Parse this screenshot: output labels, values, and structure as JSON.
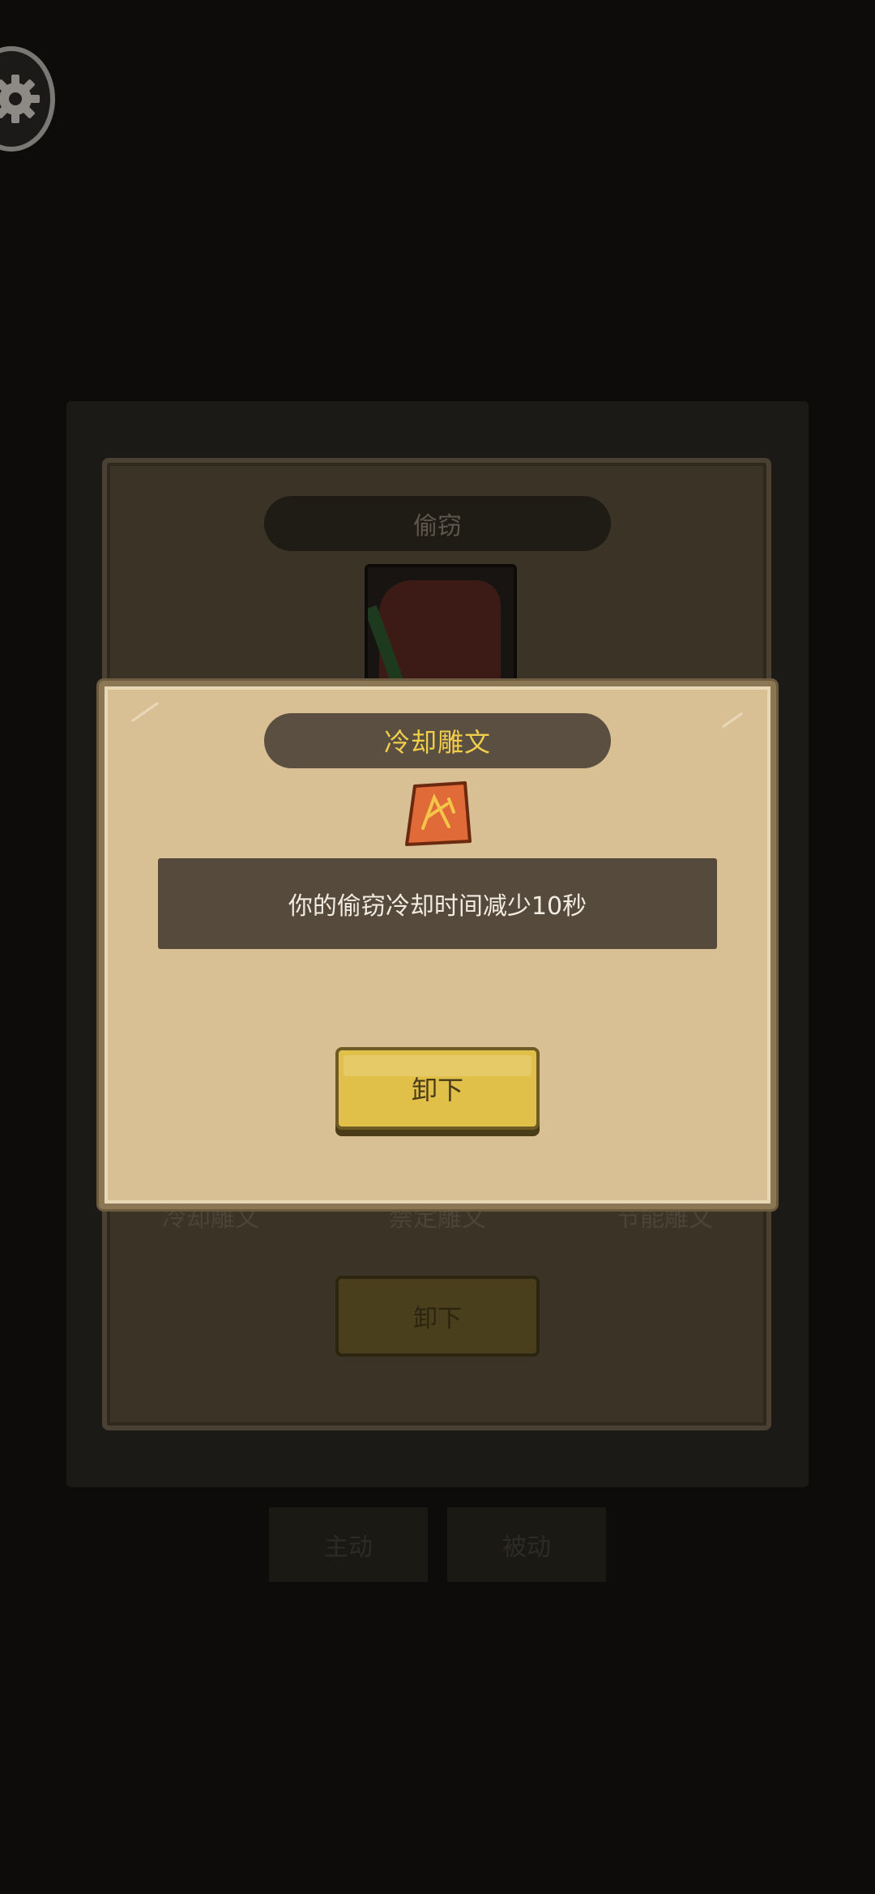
{
  "settings": {
    "icon": "gear-icon"
  },
  "background": {
    "skill_title": "偷窃",
    "rune_labels": [
      "冷却雕文",
      "禁定雕文",
      "节能雕文"
    ],
    "unload_label": "卸下",
    "tabs": [
      "主动",
      "被动"
    ]
  },
  "modal": {
    "title": "冷却雕文",
    "rune_icon": "rune-stone-icon",
    "description": "你的偷窃冷却时间减少10秒",
    "unload_label": "卸下"
  },
  "colors": {
    "accent_title": "#f0cd4a",
    "button": "#e1c04a",
    "modal_bg": "#d8bf94",
    "rune": "#e06a38"
  }
}
